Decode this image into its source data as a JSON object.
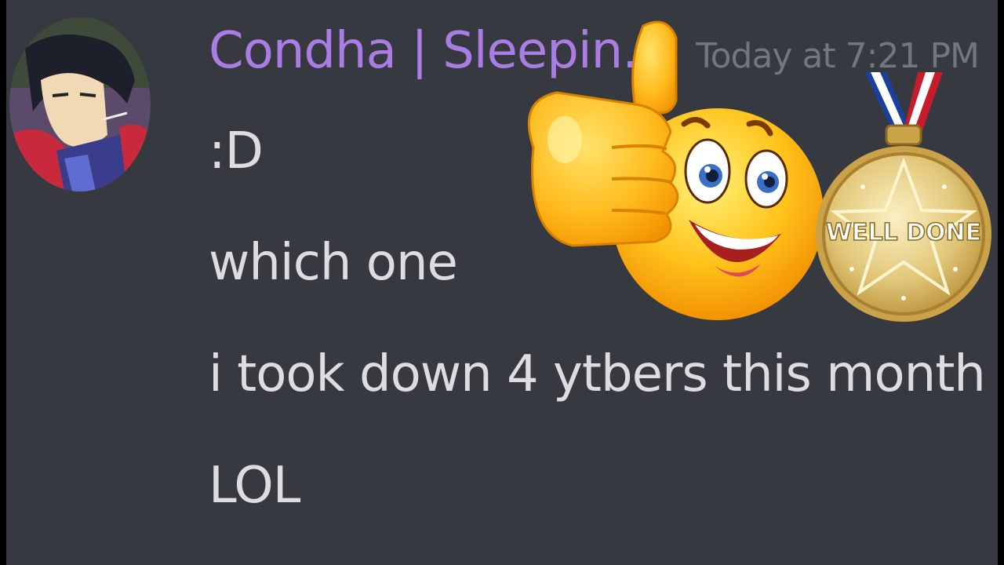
{
  "message": {
    "username": "Condha | Sleepin...",
    "timestamp": "Today at 7:21 PM",
    "lines": [
      ":D",
      "which one",
      "i took down 4 ytbers this month",
      "LOL"
    ]
  },
  "stickers": {
    "medal_text": "WELL DONE",
    "emoji": "thumbs-up-smiley-icon",
    "medal": "gold-medal-icon"
  },
  "colors": {
    "background": "#36393f",
    "username": "#a97de3",
    "message_text": "#dcddde",
    "timestamp": "#72767d"
  }
}
